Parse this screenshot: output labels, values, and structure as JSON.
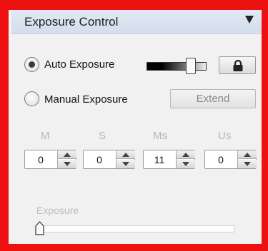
{
  "header": {
    "title": "Exposure Control",
    "collapse_icon": "triangle-down-icon"
  },
  "auto_exposure": {
    "label": "Auto Exposure",
    "selected": true,
    "lock_icon": "lock-icon"
  },
  "manual_exposure": {
    "label": "Manual Exposure",
    "selected": false,
    "extend_label": "Extend"
  },
  "time_fields": [
    {
      "unit": "M",
      "value": "0"
    },
    {
      "unit": "S",
      "value": "0"
    },
    {
      "unit": "Ms",
      "value": "11"
    },
    {
      "unit": "Us",
      "value": "0"
    }
  ],
  "exposure": {
    "label": "Exposure",
    "slider_value": 0
  },
  "colors": {
    "frame": "#ee1111",
    "header": "#d8e1ef",
    "panel": "#f1f1f1"
  }
}
